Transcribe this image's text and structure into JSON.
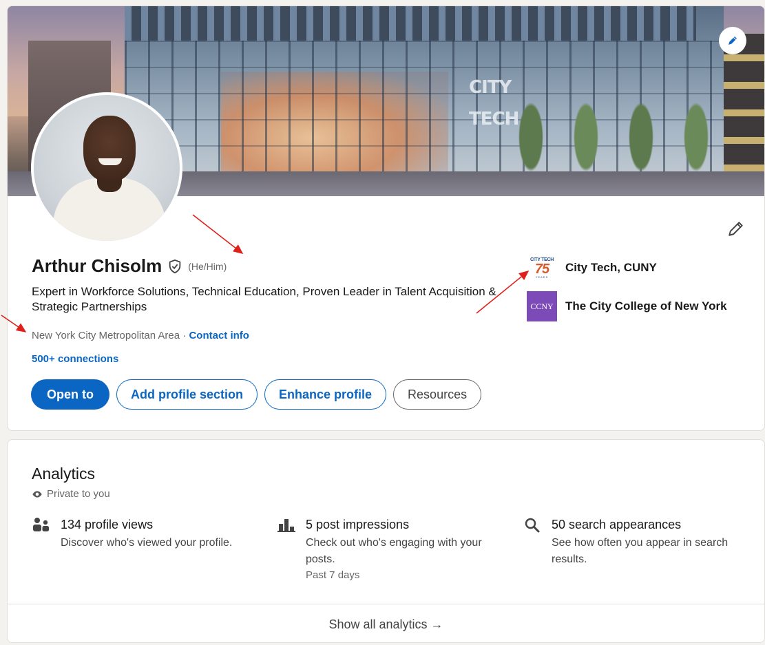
{
  "profile": {
    "name": "Arthur Chisolm",
    "pronouns": "(He/Him)",
    "headline": "Expert in Workforce Solutions, Technical Education, Proven Leader in Talent Acquisition & Strategic Partnerships",
    "location": "New York City Metropolitan Area",
    "separator": " · ",
    "contact_label": "Contact info",
    "connections": "500+ connections",
    "banner_sign": "CITY TECH"
  },
  "buttons": {
    "open_to": "Open to",
    "add_section": "Add profile section",
    "enhance": "Enhance profile",
    "resources": "Resources"
  },
  "education": [
    {
      "name": "City Tech, CUNY",
      "logo_top": "CITY TECH",
      "logo_mid": "75",
      "logo_bot": "YEARS"
    },
    {
      "name": "The City College of New York",
      "logo_text": "CCNY"
    }
  ],
  "analytics": {
    "title": "Analytics",
    "privacy": "Private to you",
    "stats": [
      {
        "icon": "people-icon",
        "title": "134 profile views",
        "desc": "Discover who's viewed your profile.",
        "sub": ""
      },
      {
        "icon": "bar-chart-icon",
        "title": "5 post impressions",
        "desc": "Check out who's engaging with your posts.",
        "sub": "Past 7 days"
      },
      {
        "icon": "search-icon",
        "title": "50 search appearances",
        "desc": "See how often you appear in search results.",
        "sub": ""
      }
    ],
    "show_all": "Show all analytics →"
  },
  "colors": {
    "accent": "#0a66c2",
    "annotation_arrow": "#e0201b"
  }
}
